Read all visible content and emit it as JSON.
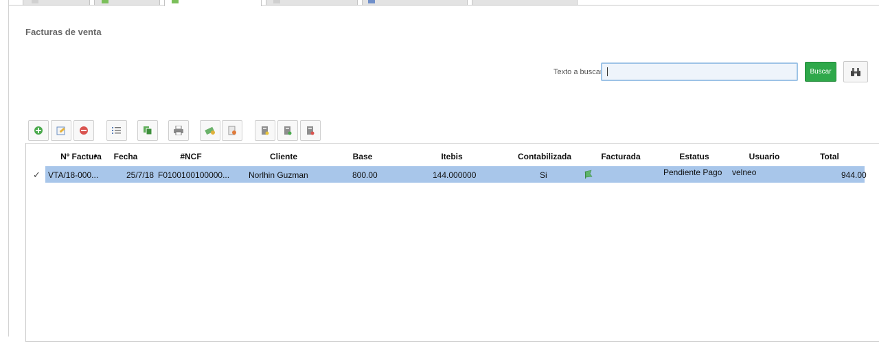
{
  "panel": {
    "title": "Facturas de venta"
  },
  "search": {
    "label": "Texto a buscar",
    "value": "",
    "button_label": "Buscar"
  },
  "toolbar": {
    "buttons": [
      "add-icon",
      "edit-icon",
      "delete-icon",
      "list-icon",
      "copy-icon",
      "print-icon",
      "money-icon",
      "user-doc-icon",
      "doc-warning-icon",
      "doc-add-icon",
      "doc-remove-icon"
    ]
  },
  "table": {
    "columns": [
      "Nº Factura",
      "Fecha",
      "#NCF",
      "Cliente",
      "Base",
      "Itebis",
      "Contabilizada",
      "Facturada",
      "Estatus",
      "Usuario",
      "Total"
    ],
    "rows": [
      {
        "selected": true,
        "factura": "VTA/18-000...",
        "fecha": "25/7/18",
        "ncf": "F0100100100000...",
        "cliente": "Norlhin Guzman",
        "base": "800.00",
        "itebis": "144.000000",
        "contabilizada": "Si",
        "facturada": "flag-icon",
        "estatus": "Pendiente Pago",
        "usuario": "velneo",
        "total": "944.00"
      }
    ]
  },
  "colors": {
    "accent_green": "#2ea84a",
    "selection": "#a8c6ea",
    "input_border": "#9dc3e6"
  }
}
